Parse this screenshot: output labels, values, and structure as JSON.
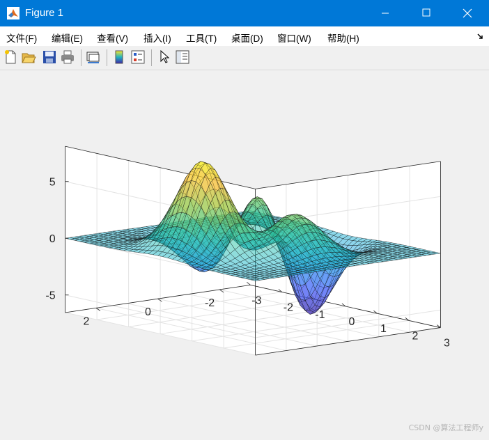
{
  "window": {
    "title": "Figure 1"
  },
  "menu": {
    "items": [
      {
        "label": "文件(F)"
      },
      {
        "label": "编辑(E)"
      },
      {
        "label": "查看(V)"
      },
      {
        "label": "插入(I)"
      },
      {
        "label": "工具(T)"
      },
      {
        "label": "桌面(D)"
      },
      {
        "label": "窗口(W)"
      },
      {
        "label": "帮助(H)"
      }
    ]
  },
  "toolbar": {
    "buttons": [
      "new-figure-icon",
      "open-file-icon",
      "save-icon",
      "print-icon",
      "link-plot-icon",
      "colorbar-icon",
      "legend-icon",
      "pointer-icon",
      "property-inspector-icon"
    ]
  },
  "chart_data": {
    "type": "surface",
    "function": "peaks",
    "x_range": [
      -3,
      3
    ],
    "y_range": [
      -3,
      3
    ],
    "grid_points": 40,
    "z_ticks": [
      "5",
      "0",
      "-5"
    ],
    "y_ticks": [
      "2",
      "0",
      "-2"
    ],
    "x_ticks": [
      "-3",
      "-2",
      "-1",
      "0",
      "1",
      "2",
      "3"
    ],
    "zlim": [
      -6.55,
      8.1
    ],
    "colormap": "parula",
    "face_alpha": 0.5,
    "grid": true,
    "peaks_note": "max 8.1 near (x=-0.0, y=1.6), min -6.55 near (x=0.2, y=-1.6)"
  },
  "watermark": "CSDN @算法工程师y"
}
